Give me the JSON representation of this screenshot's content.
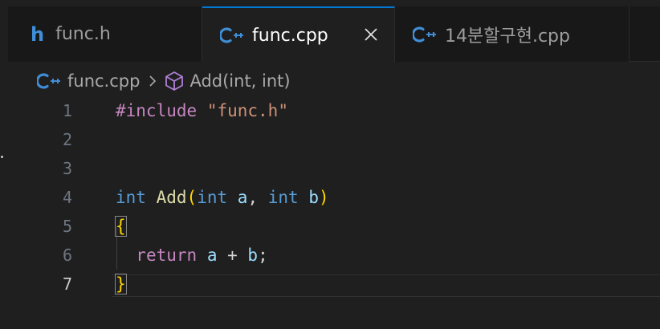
{
  "tabs": [
    {
      "label": "func.h",
      "icon": "h-file-icon",
      "active": false
    },
    {
      "label": "func.cpp",
      "icon": "cpp-file-icon",
      "active": true
    },
    {
      "label": "14분할구현.cpp",
      "icon": "cpp-file-icon",
      "active": false
    }
  ],
  "tab_h_glyph": "h",
  "close_icon": "close-icon",
  "breadcrumb": {
    "file": "func.cpp",
    "separator_icon": "chevron-right-icon",
    "symbol_icon": "cube-icon",
    "symbol": "Add(int, int)"
  },
  "editor": {
    "active_line": 7,
    "lines": [
      {
        "num": "1",
        "tokens": [
          "#include",
          " ",
          "\"func.h\""
        ]
      },
      {
        "num": "2",
        "tokens": []
      },
      {
        "num": "3",
        "tokens": []
      },
      {
        "num": "4",
        "tokens": [
          "int",
          " ",
          "Add",
          "(",
          "int",
          " ",
          "a",
          ", ",
          "int",
          " ",
          "b",
          ")"
        ]
      },
      {
        "num": "5",
        "tokens": [
          "{"
        ]
      },
      {
        "num": "6",
        "tokens": [
          "  ",
          "return",
          " ",
          "a",
          " + ",
          "b",
          ";"
        ]
      },
      {
        "num": "7",
        "tokens": [
          "}"
        ]
      }
    ]
  },
  "colors": {
    "accent": "#0078d4",
    "cpp_icon": "#3f8ed6",
    "symbol_icon": "#b180d7",
    "preprocessor": "#c586c0",
    "string": "#ce9178",
    "type": "#569cd6",
    "function": "#dcdcaa",
    "bracket": "#ffd700",
    "parameter": "#9cdcfe"
  }
}
